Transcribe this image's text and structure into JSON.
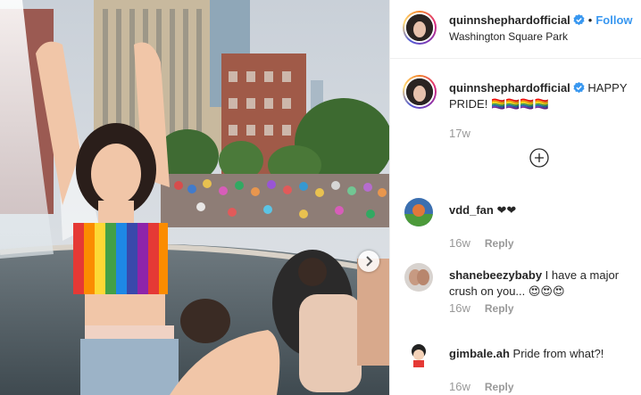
{
  "post_owner": {
    "username": "quinnshephardofficial",
    "follow_label": "Follow",
    "separator": "•",
    "location": "Washington Square Park"
  },
  "caption": {
    "username": "quinnshephardofficial",
    "text": "HAPPY PRIDE! 🏳️‍🌈🏳️‍🌈🏳️‍🌈🏳️‍🌈",
    "time": "17w"
  },
  "comments": [
    {
      "username": "vdd_fan",
      "text": "❤❤",
      "time": "16w",
      "reply_label": "Reply"
    },
    {
      "username": "shanebeezybaby",
      "text": "I have a major crush on you... 😍😍😍",
      "time": "16w",
      "reply_label": "Reply"
    },
    {
      "username": "gimbale.ah",
      "text": "Pride from what?!",
      "time": "16w",
      "reply_label": "Reply"
    }
  ],
  "icons": {
    "verified": "verified-badge-icon",
    "load_more": "plus-circle-icon",
    "carousel_next": "chevron-right-icon"
  },
  "colors": {
    "follow": "#3897f0",
    "verified": "#3897f0",
    "muted": "#999999"
  }
}
